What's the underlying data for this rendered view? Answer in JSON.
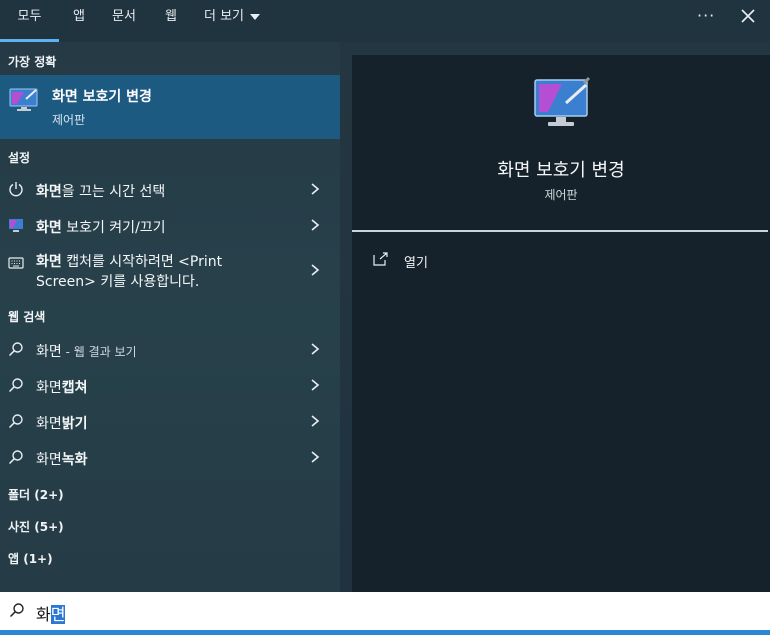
{
  "tabs": [
    {
      "label": "모두",
      "active": true
    },
    {
      "label": "앱"
    },
    {
      "label": "문서"
    },
    {
      "label": "웹"
    },
    {
      "label": "더 보기"
    }
  ],
  "toolbar": {
    "more_options_label": "···"
  },
  "sections": {
    "best_match": "가장 정확",
    "settings": "설정",
    "web_search": "웹 검색",
    "folders": "폴더 (2+)",
    "photos": "사진 (5+)",
    "apps": "앱 (1+)"
  },
  "best_match": {
    "title": "화면 보호기 변경",
    "subtitle": "제어판"
  },
  "settings_items": [
    {
      "bold": "화면",
      "rest": "을 끄는 시간 선택",
      "icon": "power-icon"
    },
    {
      "bold": "화면",
      "rest": " 보호기 켜기/끄기",
      "icon": "screensaver-icon"
    },
    {
      "bold": "화면",
      "rest": " 캡처를 시작하려면 <Print",
      "line2": "Screen> 키를 사용합니다.",
      "icon": "keyboard-icon"
    }
  ],
  "web_items": [
    {
      "bold": "화면",
      "small": " - 웹 결과 보기"
    },
    {
      "plain": "화면",
      "bold": "캡쳐"
    },
    {
      "plain": "화면",
      "bold": "밝기"
    },
    {
      "plain": "화면",
      "bold": "녹화"
    }
  ],
  "detail": {
    "title": "화면 보호기 변경",
    "subtitle": "제어판",
    "open_label": "열기"
  },
  "search": {
    "typed": "화",
    "selected": "면"
  },
  "colors": {
    "accent": "#5fb2f2",
    "selection": "#1d5a82",
    "search_highlight": "#2a78d6"
  }
}
